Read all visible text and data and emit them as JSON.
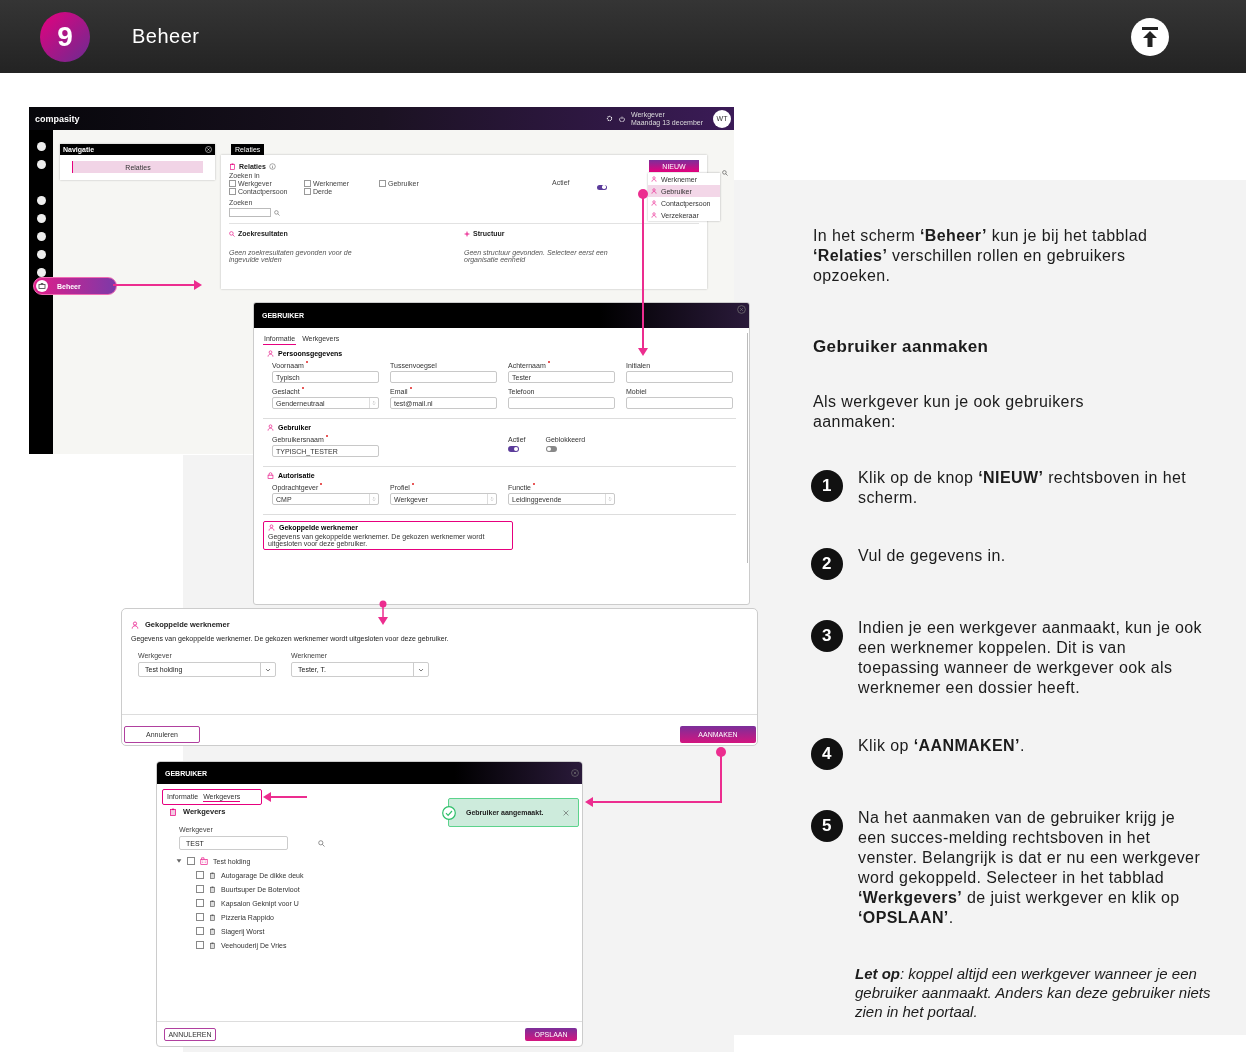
{
  "header": {
    "step": "9",
    "title": "Beheer"
  },
  "overview": {
    "logo": "compasity",
    "user_role": "Werkgever",
    "date": "Maandag 13 december",
    "avatar": "WT",
    "sidebar_item": "Beheer",
    "navigation": {
      "title": "Navigatie",
      "item": "Relaties"
    },
    "tab": "Relaties",
    "panel": {
      "title": "Relaties",
      "search_in_label": "Zoeken in",
      "filters": [
        {
          "label": "Werkgever",
          "checked": false
        },
        {
          "label": "Werknemer",
          "checked": false
        },
        {
          "label": "Gebruiker",
          "checked": false
        },
        {
          "label": "Contactpersoon",
          "checked": false
        },
        {
          "label": "Derde",
          "checked": false
        }
      ],
      "active_label": "Actief",
      "active_on": true,
      "search_label": "Zoeken",
      "results_title": "Zoekresultaten",
      "results_text": "Geen zoekresultaten gevonden voor de ingevulde velden",
      "structure_title": "Structuur",
      "structure_text": "Geen structuur gevonden. Selecteer eerst een organisatie eenheid"
    },
    "new_button": "NIEUW",
    "menu": [
      {
        "label": "Werknemer",
        "selected": false
      },
      {
        "label": "Gebruiker",
        "selected": true
      },
      {
        "label": "Contactpersoon",
        "selected": false
      },
      {
        "label": "Verzekeraar",
        "selected": false
      }
    ]
  },
  "user_form": {
    "title": "GEBRUIKER",
    "tabs": [
      {
        "label": "Informatie",
        "selected": true
      },
      {
        "label": "Werkgevers",
        "selected": false
      }
    ],
    "sections": [
      {
        "title": "Persoonsgegevens",
        "fields": [
          {
            "kind": "text",
            "label": "Voornaam",
            "required": true,
            "value": "Typisch"
          },
          {
            "kind": "text",
            "label": "Tussenvoegsel",
            "required": false
          },
          {
            "kind": "text",
            "label": "Achternaam",
            "required": true,
            "value": "Tester"
          },
          {
            "kind": "text",
            "label": "Initialen",
            "required": false
          },
          {
            "kind": "select",
            "label": "Geslacht",
            "required": true,
            "value": "Genderneutraal"
          },
          {
            "kind": "text",
            "label": "Email",
            "required": true,
            "value": "test@mail.nl"
          },
          {
            "kind": "text",
            "label": "Telefoon",
            "required": false
          },
          {
            "kind": "text",
            "label": "Mobiel",
            "required": false
          }
        ]
      },
      {
        "title": "Gebruiker",
        "fields": [
          {
            "kind": "text",
            "label": "Gebruikersnaam",
            "required": true,
            "value": "TYPISCH_TESTER"
          },
          {
            "kind": "toggle",
            "label": "Actief",
            "on": true
          },
          {
            "kind": "toggle",
            "label": "Geblokkeerd",
            "on": false
          }
        ]
      },
      {
        "title": "Autorisatie",
        "fields": [
          {
            "kind": "select",
            "label": "Opdrachtgever",
            "required": true,
            "value": "CMP"
          },
          {
            "kind": "select",
            "label": "Profiel",
            "required": true,
            "value": "Werkgever"
          },
          {
            "kind": "select",
            "label": "Functie",
            "required": true,
            "value": "Leidinggevende"
          }
        ]
      }
    ],
    "linked": {
      "title": "Gekoppelde werknemer",
      "text": "Gegevens van gekoppelde werknemer. De gekozen werknemer wordt uitgesloten voor deze gebruiker."
    }
  },
  "linked_dialog": {
    "title": "Gekoppelde werknemer",
    "text": "Gegevens van gekoppelde werknemer. De gekozen werknemer wordt uitgesloten voor deze gebruiker.",
    "fields": [
      {
        "label": "Werkgever",
        "value": "Test holding"
      },
      {
        "label": "Werknemer",
        "value": "Tester, T."
      }
    ],
    "cancel": "Annuleren",
    "create": "AANMAKEN"
  },
  "employers_dialog": {
    "title": "GEBRUIKER",
    "tabs": [
      {
        "label": "Informatie",
        "selected": false
      },
      {
        "label": "Werkgevers",
        "selected": true
      }
    ],
    "section_title": "Werkgevers",
    "search_label": "Werkgever",
    "search_value": "TEST",
    "tree": [
      {
        "label": "Test holding",
        "checked": false,
        "expanded": true,
        "children": [
          {
            "label": "Autogarage De dikke deuk",
            "checked": false
          },
          {
            "label": "Buurtsuper De Botervloot",
            "checked": false
          },
          {
            "label": "Kapsalon Geknipt voor U",
            "checked": false
          },
          {
            "label": "Pizzeria Rappido",
            "checked": false
          },
          {
            "label": "Slagerij Worst",
            "checked": false
          },
          {
            "label": "Veehouderij De Vries",
            "checked": false
          }
        ]
      }
    ],
    "toast": "Gebruiker aangemaakt.",
    "cancel": "ANNULEREN",
    "save": "OPSLAAN"
  },
  "instructions": {
    "intro": "In het scherm **‘Beheer’** kun je bij het tabblad **‘Relaties’** verschillen rollen en gebruikers opzoeken.",
    "heading": "Gebruiker aanmaken",
    "lead": "Als werkgever kun je ook gebruikers aanmaken:",
    "steps": [
      {
        "number": "1",
        "text": "Klik op de knop **‘NIEUW’** rechtsboven in het scherm."
      },
      {
        "number": "2",
        "text": "Vul de gegevens in."
      },
      {
        "number": "3",
        "text": "Indien je een werkgever aanmaakt, kun je ook een werknemer koppelen. Dit is van toepassing wanneer de werkgever ook als werknemer een dossier heeft."
      },
      {
        "number": "4",
        "text": "Klik op **‘AANMAKEN’**."
      },
      {
        "number": "5",
        "text": "Na het aanmaken van de gebruiker krijg je een succes-melding rechtsboven in het venster. Belangrijk is dat er nu een werkgever word gekoppeld. Selecteer in het tabblad **‘Werkgevers’** de juist werkgever en klik op **‘OPSLAAN’**."
      }
    ],
    "note": "**Let op**: koppel altijd een werkgever wanneer je een gebruiker aanmaakt. Anders kan deze gebruiker niets zien in het portaal."
  }
}
